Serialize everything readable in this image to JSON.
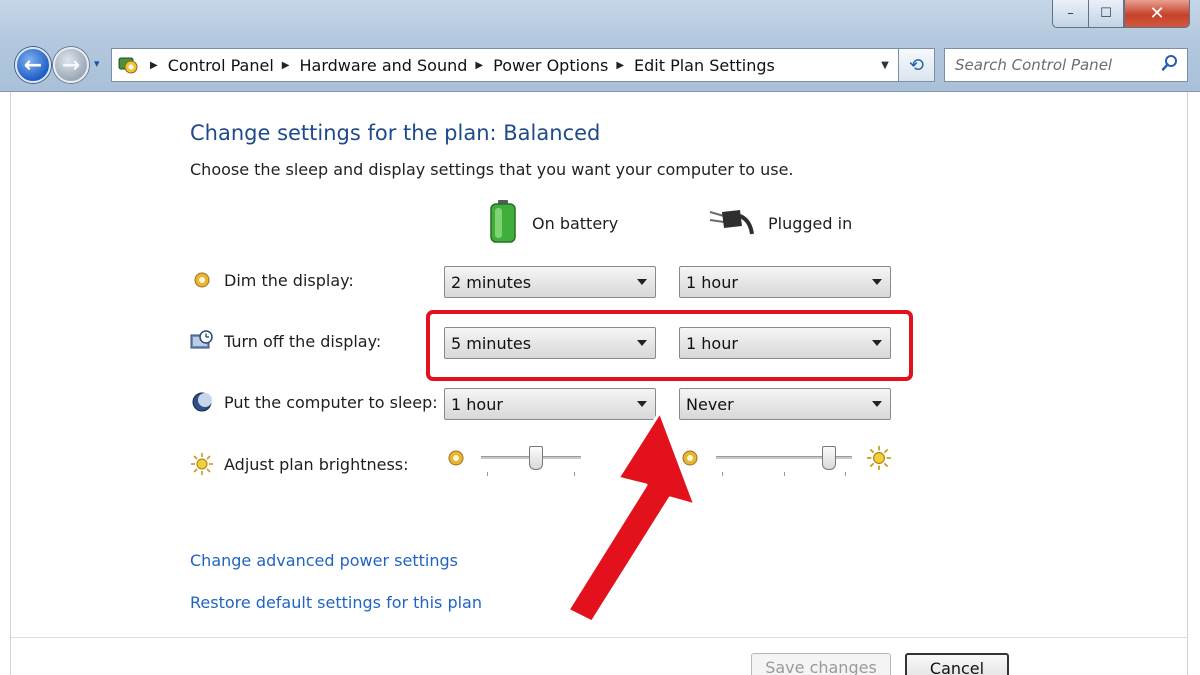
{
  "window": {
    "title": "",
    "controls": {
      "minimize": "–",
      "maximize": "☐",
      "close": "✕"
    }
  },
  "nav": {
    "back": "←",
    "forward": "→",
    "history": "▾"
  },
  "address": {
    "crumbs": [
      "Control Panel",
      "Hardware and Sound",
      "Power Options",
      "Edit Plan Settings"
    ],
    "separator": "▶",
    "dropdown": "▼",
    "refresh": "⟲"
  },
  "search": {
    "placeholder": "Search Control Panel"
  },
  "page": {
    "title": "Change settings for the plan: Balanced",
    "subtitle": "Choose the sleep and display settings that you want your computer to use."
  },
  "columns": {
    "battery": "On battery",
    "plugged": "Plugged in"
  },
  "rows": [
    {
      "label": "Dim the display:",
      "battery": "2 minutes",
      "plugged": "1 hour"
    },
    {
      "label": "Turn off the display:",
      "battery": "5 minutes",
      "plugged": "1 hour"
    },
    {
      "label": "Put the computer to sleep:",
      "battery": "1 hour",
      "plugged": "Never"
    },
    {
      "label": "Adjust plan brightness:"
    }
  ],
  "brightness": {
    "battery": 0.55,
    "plugged": 0.83
  },
  "links": {
    "advanced": "Change advanced power settings",
    "restore": "Restore default settings for this plan"
  },
  "buttons": {
    "save": "Save changes",
    "cancel": "Cancel"
  },
  "colors": {
    "accent_title": "#1e4a8c",
    "link": "#1f64c4",
    "highlight": "#e3111c",
    "battery_green": "#3fae3a"
  },
  "icons": {
    "dim": "dim-display-icon",
    "off": "monitor-clock-icon",
    "sleep": "moon-icon",
    "brightness": "sun-icon",
    "battery": "battery-icon",
    "plug": "power-plug-icon"
  }
}
